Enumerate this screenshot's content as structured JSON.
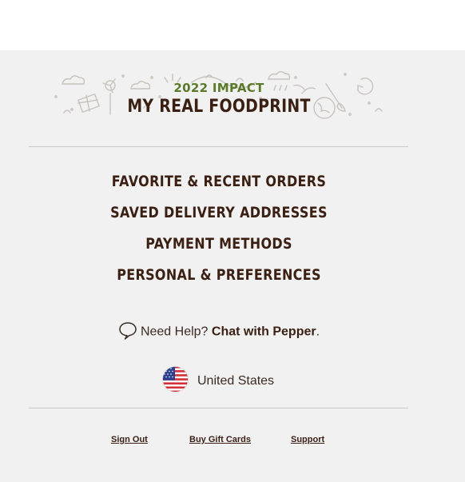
{
  "impact": {
    "year_label": "2022 IMPACT",
    "title": "MY REAL FOODPRINT"
  },
  "menu": [
    {
      "label": "FAVORITE & RECENT ORDERS"
    },
    {
      "label": "SAVED DELIVERY ADDRESSES"
    },
    {
      "label": "PAYMENT METHODS"
    },
    {
      "label": "PERSONAL & PREFERENCES"
    }
  ],
  "help": {
    "icon": "chat-bubble-icon",
    "prefix": "Need Help?",
    "link": "Chat with Pepper",
    "suffix": "."
  },
  "country": {
    "icon": "us-flag-icon",
    "label": "United States"
  },
  "footer": {
    "sign_out": "Sign Out",
    "gift_cards": "Buy Gift Cards",
    "support": "Support"
  },
  "colors": {
    "panel_bg": "#f1f1f1",
    "heading": "#3a1f12",
    "impact_green": "#5a7a2a"
  }
}
